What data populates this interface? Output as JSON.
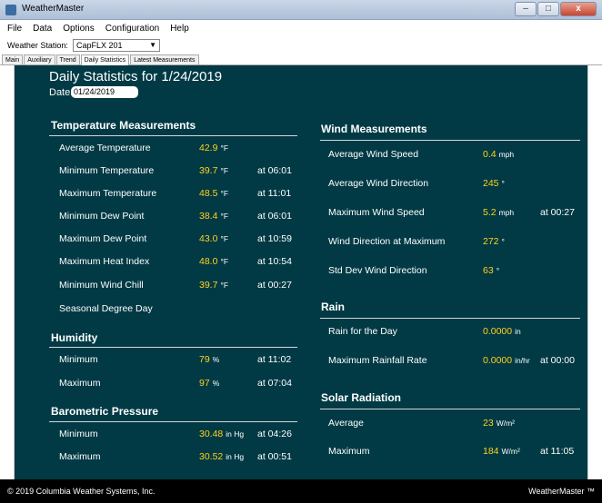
{
  "window": {
    "title": "WeatherMaster",
    "minimize": "–",
    "maximize": "□",
    "close": "x"
  },
  "menu": [
    "File",
    "Data",
    "Options",
    "Configuration",
    "Help"
  ],
  "station": {
    "label": "Weather Station:",
    "value": "CapFLX 201"
  },
  "tabs": [
    "Main",
    "Auxiliary",
    "Trend",
    "Daily Statistics",
    "Latest Measurements"
  ],
  "heading": "Daily Statistics for 1/24/2019",
  "date": {
    "label": "Date:",
    "value": "01/24/2019"
  },
  "temperature": {
    "title": "Temperature Measurements",
    "rows": [
      {
        "label": "Average Temperature",
        "value": "42.9",
        "unit": "°F",
        "time": ""
      },
      {
        "label": "Minimum Temperature",
        "value": "39.7",
        "unit": "°F",
        "time": "at 06:01"
      },
      {
        "label": "Maximum Temperature",
        "value": "48.5",
        "unit": "°F",
        "time": "at 11:01"
      },
      {
        "label": "Minimum Dew Point",
        "value": "38.4",
        "unit": "°F",
        "time": "at 06:01"
      },
      {
        "label": "Maximum Dew Point",
        "value": "43.0",
        "unit": "°F",
        "time": "at 10:59"
      },
      {
        "label": "Maximum Heat Index",
        "value": "48.0",
        "unit": "°F",
        "time": "at 10:54"
      },
      {
        "label": "Minimum Wind Chill",
        "value": "39.7",
        "unit": "°F",
        "time": "at 00:27"
      },
      {
        "label": "Seasonal Degree Day",
        "value": "",
        "unit": "",
        "time": ""
      }
    ]
  },
  "humidity": {
    "title": "Humidity",
    "rows": [
      {
        "label": "Minimum",
        "value": "79",
        "unit": "%",
        "time": "at 11:02"
      },
      {
        "label": "Maximum",
        "value": "97",
        "unit": "%",
        "time": "at 07:04"
      }
    ]
  },
  "pressure": {
    "title": "Barometric Pressure",
    "rows": [
      {
        "label": "Minimum",
        "value": "30.48",
        "unit": "in Hg",
        "time": "at 04:26"
      },
      {
        "label": "Maximum",
        "value": "30.52",
        "unit": "in Hg",
        "time": "at 00:51"
      }
    ]
  },
  "wind": {
    "title": "Wind Measurements",
    "rows": [
      {
        "label": "Average Wind Speed",
        "value": "0.4",
        "unit": "mph",
        "time": ""
      },
      {
        "label": "Average Wind Direction",
        "value": "245",
        "unit": "°",
        "time": ""
      },
      {
        "label": "Maximum Wind Speed",
        "value": "5.2",
        "unit": "mph",
        "time": "at 00:27"
      },
      {
        "label": "Wind Direction at Maximum",
        "value": "272",
        "unit": "°",
        "time": ""
      },
      {
        "label": "Std Dev Wind Direction",
        "value": "63",
        "unit": "°",
        "time": ""
      }
    ]
  },
  "rain": {
    "title": "Rain",
    "rows": [
      {
        "label": "Rain for the Day",
        "value": "0.0000",
        "unit": "in",
        "time": ""
      },
      {
        "label": "Maximum Rainfall Rate",
        "value": "0.0000",
        "unit": "in/hr",
        "time": "at 00:00"
      }
    ]
  },
  "solar": {
    "title": "Solar Radiation",
    "rows": [
      {
        "label": "Average",
        "value": "23",
        "unit": "W/m²",
        "time": ""
      },
      {
        "label": "Maximum",
        "value": "184",
        "unit": "W/m²",
        "time": "at 11:05"
      }
    ]
  },
  "footer": {
    "copyright": "© 2019 Columbia Weather Systems, Inc.",
    "brand": "WeatherMaster ™"
  }
}
